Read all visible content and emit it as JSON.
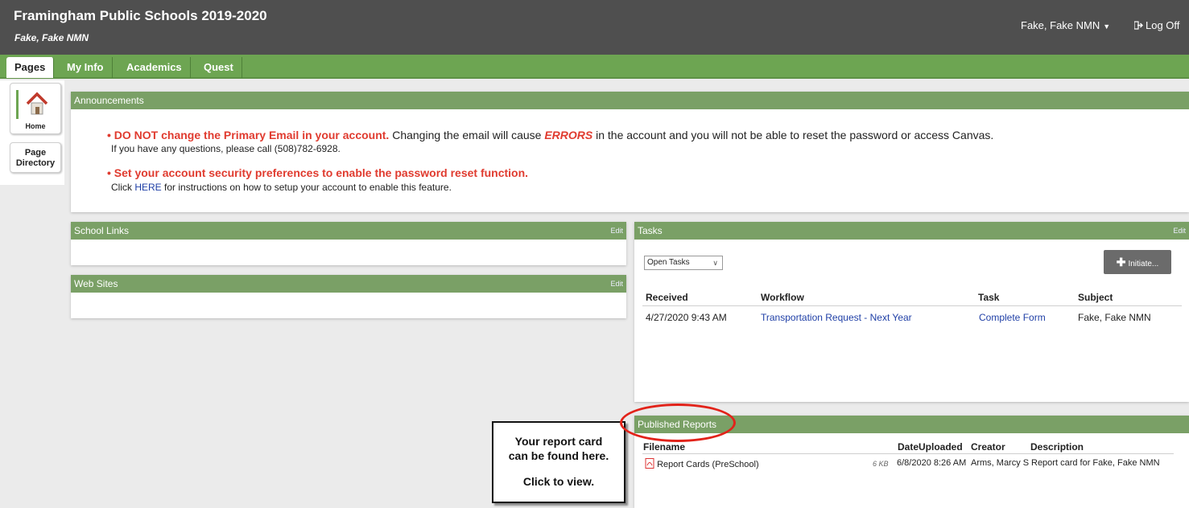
{
  "header": {
    "title": "Framingham Public Schools 2019-2020",
    "subtitle": "Fake, Fake NMN",
    "user_menu": "Fake, Fake NMN",
    "logoff": "Log Off"
  },
  "nav": {
    "tabs": [
      {
        "label": "Pages",
        "active": true
      },
      {
        "label": "My Info"
      },
      {
        "label": "Academics"
      },
      {
        "label": "Quest"
      }
    ]
  },
  "sidebar": {
    "home": "Home",
    "page_directory_line1": "Page",
    "page_directory_line2": "Directory"
  },
  "announcements": {
    "title": "Announcements",
    "item1_bold": "DO NOT change the Primary Email in your account.",
    "item1_text_a": " Changing the email will cause ",
    "item1_errors": "ERRORS",
    "item1_text_b": " in the account and you will not be able to reset the password or access Canvas.",
    "item1_sub": "If you have any questions, please call (508)782-6928.",
    "item2_bold": "Set your account security preferences to enable the password reset function.",
    "item2_sub_a": "Click ",
    "item2_link": "HERE",
    "item2_sub_b": " for instructions on how to setup your account to enable this feature."
  },
  "school_links": {
    "title": "School Links",
    "edit": "Edit"
  },
  "web_sites": {
    "title": "Web Sites",
    "edit": "Edit"
  },
  "tasks": {
    "title": "Tasks",
    "edit": "Edit",
    "filter": "Open Tasks",
    "initiate": "Initiate...",
    "columns": [
      "Received",
      "Workflow",
      "Task",
      "Subject"
    ],
    "rows": [
      {
        "received": "4/27/2020 9:43 AM",
        "workflow": "Transportation Request - Next Year",
        "task": "Complete Form",
        "subject": "Fake, Fake NMN"
      }
    ]
  },
  "published_reports": {
    "title": "Published Reports",
    "columns": [
      "Filename",
      "DateUploaded",
      "Creator",
      "Description"
    ],
    "rows": [
      {
        "filename": "Report Cards (PreSchool)",
        "size": "6 KB",
        "date": "6/8/2020 8:26 AM",
        "creator": "Arms, Marcy S",
        "description": "Report card for Fake, Fake NMN"
      }
    ]
  },
  "callout": {
    "line1": "Your report card",
    "line2": "can be found here.",
    "line3": "Click to view."
  },
  "colors": {
    "header": "#4f4f4f",
    "nav_green": "#6da552",
    "panel_head": "#7aa066",
    "alert_red": "#e03b2f"
  }
}
